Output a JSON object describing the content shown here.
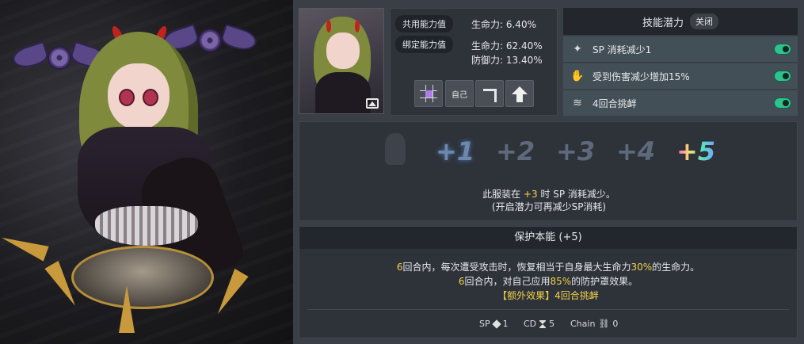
{
  "stats": {
    "shared_tag": "共用能力值",
    "shared_hp": "生命力: 6.40%",
    "bound_tag": "绑定能力值",
    "bound_hp": "生命力: 62.40%",
    "bound_def": "防御力: 13.40%",
    "self_button": "自己"
  },
  "skills": {
    "title": "技能潜力",
    "toggle_state": "关闭",
    "items": [
      {
        "label": "SP 消耗减少1",
        "icon": "star-icon"
      },
      {
        "label": "受到伤害减少增加15%",
        "icon": "hand-icon"
      },
      {
        "label": "4回合挑衅",
        "icon": "wind-icon"
      }
    ]
  },
  "potential": {
    "levels": [
      "+1",
      "+2",
      "+3",
      "+4",
      "+5"
    ],
    "line1_a": "此服装在 ",
    "line1_hl": "+3",
    "line1_b": " 时 SP 消耗减少。",
    "line2": "(开启潜力可再减少SP消耗)"
  },
  "protect": {
    "title": "保护本能 (+5)",
    "l1_n": "6",
    "l1_a": "回合内，每次遭受攻击时，恢复相当于自身最大生命力",
    "l1_pct": "30%",
    "l1_b": "的生命力。",
    "l2_n": "6",
    "l2_a": "回合内，对自己应用",
    "l2_pct": "85%",
    "l2_b": "的防护罩效果。",
    "bonus": "【额外效果】4回合挑衅",
    "sp_label": "SP",
    "sp_value": "1",
    "cd_label": "CD",
    "cd_value": "5",
    "chain_label": "Chain",
    "chain_value": "0"
  }
}
